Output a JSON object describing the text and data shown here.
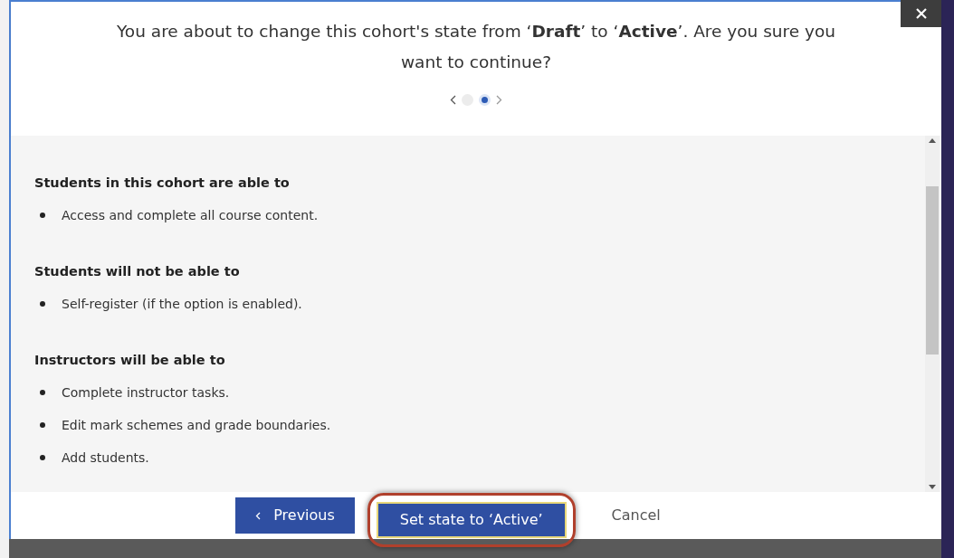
{
  "dialog": {
    "message": "You are about to change this cohort's state from ‘**Draft**’ to ‘**Active**’. Are you sure you want to continue?",
    "pager": {
      "dots": [
        {
          "selected": false
        },
        {
          "selected": true
        }
      ]
    },
    "sections": [
      {
        "heading": "Students in this cohort are able to",
        "items": [
          "Access and complete all course content."
        ]
      },
      {
        "heading": "Students will not be able to",
        "items": [
          "Self-register (if the option is enabled)."
        ]
      },
      {
        "heading": "Instructors will be able to",
        "items": [
          "Complete instructor tasks.",
          "Edit mark schemes and grade boundaries.",
          "Add students."
        ]
      }
    ],
    "buttons": [
      {
        "kind": "previous",
        "label": "Previous",
        "highlighted": false
      },
      {
        "kind": "primary",
        "label": "Set state to ‘Active’",
        "highlighted": true
      },
      {
        "kind": "cancel",
        "label": "Cancel",
        "highlighted": false
      }
    ]
  }
}
